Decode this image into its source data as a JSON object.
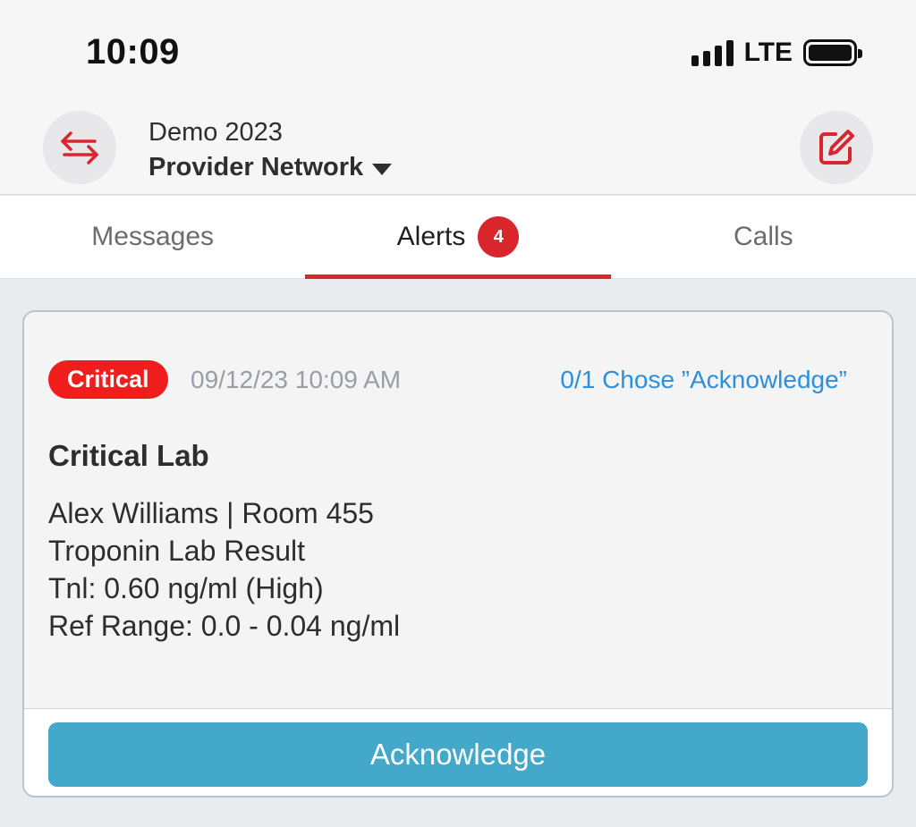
{
  "status_bar": {
    "time": "10:09",
    "network": "LTE",
    "battery_level": 1.0,
    "signal_bars": 4
  },
  "header": {
    "org_name": "Demo 2023",
    "network_name": "Provider Network",
    "switch_icon": "swap-arrows-icon",
    "compose_icon": "compose-icon",
    "accent_color": "#d8262c"
  },
  "tabs": [
    {
      "label": "Messages",
      "active": false
    },
    {
      "label": "Alerts",
      "active": true,
      "badge": "4"
    },
    {
      "label": "Calls",
      "active": false
    }
  ],
  "alert": {
    "severity": "Critical",
    "severity_color": "#f01d1d",
    "timestamp": "09/12/23 10:09 AM",
    "response_status": "0/1 Chose ”Acknowledge”",
    "title": "Critical Lab",
    "lines": [
      "Alex Williams | Room 455",
      "Troponin Lab Result",
      "Tnl: 0.60 ng/ml (High)",
      "Ref Range: 0.0 - 0.04 ng/ml"
    ],
    "action_label": "Acknowledge",
    "action_color": "#43a8c9"
  }
}
